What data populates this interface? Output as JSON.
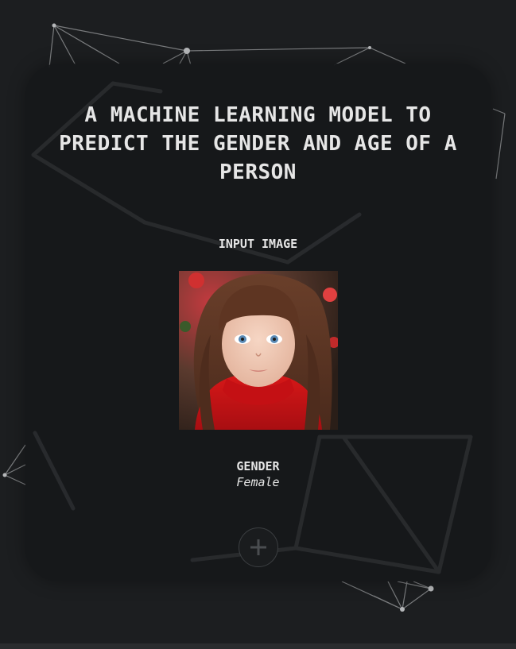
{
  "header": {
    "title_lines": [
      "A MACHINE LEARNING MODEL TO",
      "PREDICT THE GENDER AND AGE OF A",
      "PERSON"
    ]
  },
  "input": {
    "label": "INPUT IMAGE"
  },
  "result": {
    "gender_label": "GENDER",
    "gender_value": "Female"
  },
  "actions": {
    "add_icon": "plus-icon"
  },
  "colors": {
    "background": "#1c1e20",
    "card": "#16181a",
    "text": "#e6e6e6",
    "network_lines": "#9a9a9a"
  }
}
